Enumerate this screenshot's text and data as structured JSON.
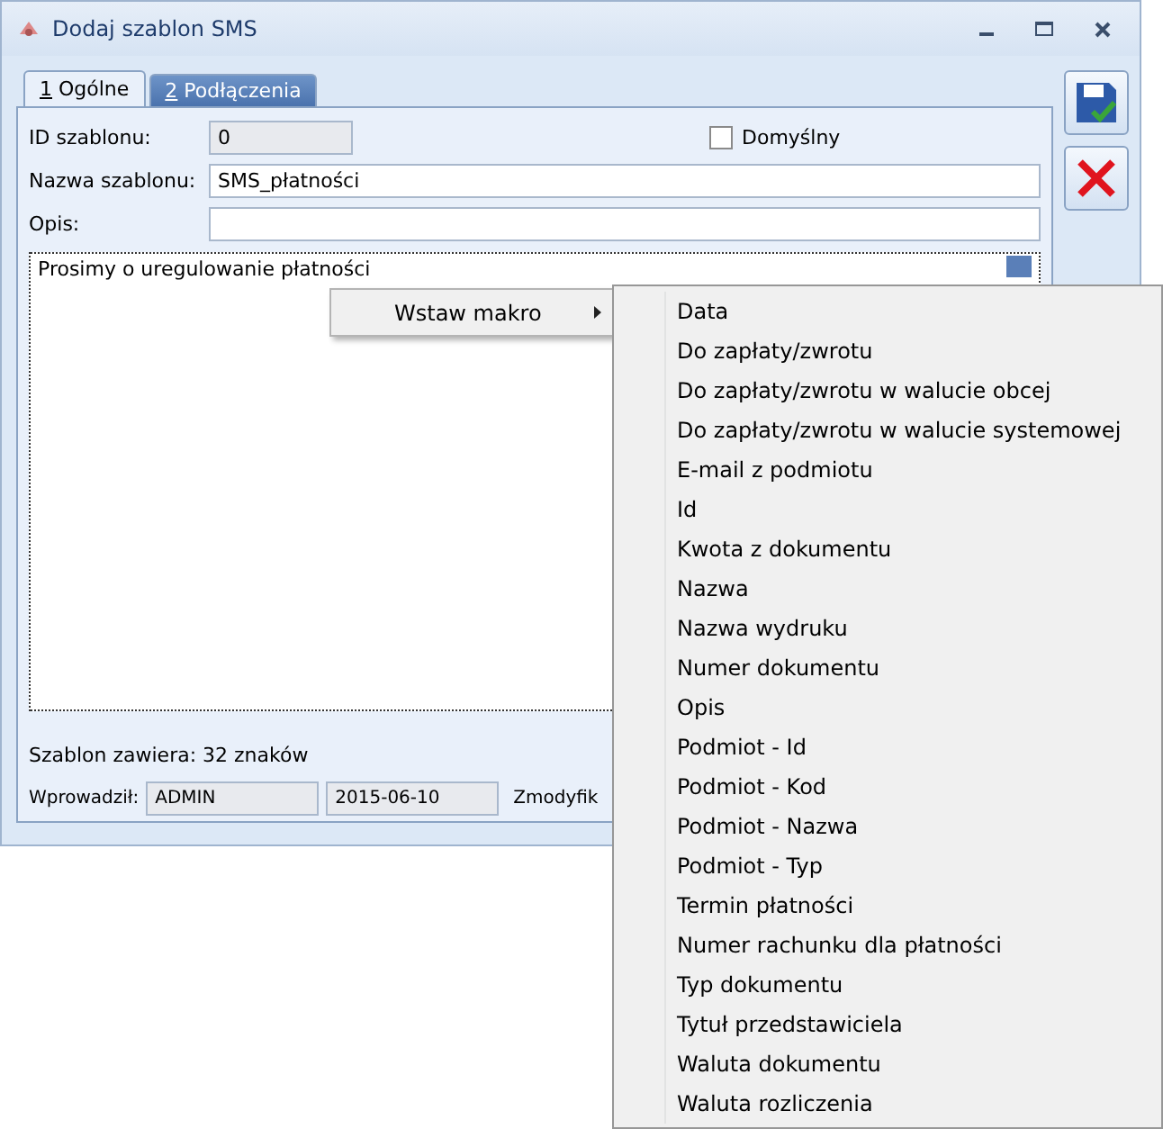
{
  "window": {
    "title": "Dodaj szablon SMS"
  },
  "tabs": [
    {
      "key": "1",
      "label": " Ogólne",
      "selected": true
    },
    {
      "key": "2",
      "label": " Podłączenia",
      "selected": false
    }
  ],
  "form": {
    "id_label": "ID szablonu:",
    "id_value": "0",
    "default_label": "Domyślny",
    "default_checked": false,
    "name_label": "Nazwa szablonu:",
    "name_value": "SMS_płatności",
    "desc_label": "Opis:",
    "body": "Prosimy o uregulowanie płatności",
    "count": "Szablon zawiera: 32 znaków",
    "entered_label": "Wprowadził:",
    "entered_by": "ADMIN",
    "entered_date": "2015-06-10",
    "modified_label": "Zmodyfik"
  },
  "context_menu": {
    "items": [
      {
        "label": "Wstaw makro",
        "submenu": true
      }
    ]
  },
  "submenu": {
    "items": [
      "Data",
      "Do zapłaty/zwrotu",
      "Do zapłaty/zwrotu w walucie obcej",
      "Do zapłaty/zwrotu w walucie systemowej",
      "E-mail z podmiotu",
      "Id",
      "Kwota z dokumentu",
      "Nazwa",
      "Nazwa wydruku",
      "Numer dokumentu",
      "Opis",
      "Podmiot - Id",
      "Podmiot - Kod",
      "Podmiot - Nazwa",
      "Podmiot - Typ",
      "Termin płatności",
      "Numer rachunku dla płatności",
      "Typ dokumentu",
      "Tytuł przedstawiciela",
      "Waluta dokumentu",
      "Waluta rozliczenia"
    ]
  }
}
